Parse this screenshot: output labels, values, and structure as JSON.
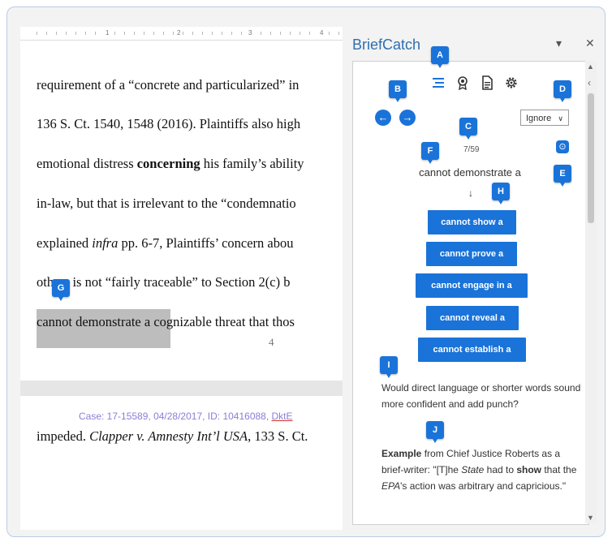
{
  "document": {
    "ruler_numbers": [
      "1",
      "2",
      "3",
      "4"
    ],
    "lines": [
      {
        "parts": [
          {
            "t": "requirement of a “concrete and particularized” in"
          }
        ]
      },
      {
        "parts": [
          {
            "t": "136 S. Ct. 1540, 1548 (2016).  Plaintiffs also high"
          }
        ]
      },
      {
        "parts": [
          {
            "t": "emotional distress "
          },
          {
            "t": "concerning",
            "b": true
          },
          {
            "t": " his family’s ability"
          }
        ]
      },
      {
        "parts": [
          {
            "t": "in-law, but that is irrelevant to the “condemnatio"
          }
        ]
      },
      {
        "parts": [
          {
            "t": "explained "
          },
          {
            "t": "infra",
            "i": true
          },
          {
            "t": " pp. 6-7, Plaintiffs’ concern abou"
          }
        ]
      },
      {
        "parts": [
          {
            "t": "others is not “fairly traceable” to Section 2(c) b"
          }
        ]
      },
      {
        "parts": [
          {
            "t": "cannot demonstrate a cognizable threat that thos"
          }
        ]
      }
    ],
    "page_number": "4",
    "case_line": "Case: 17-15589, 04/28/2017, ID: 10416088, ",
    "case_line_link": "DktE",
    "page2_line": [
      {
        "t": "impeded. "
      },
      {
        "t": "Clapper v. Amnesty Int’l USA",
        "i": true
      },
      {
        "t": ", 133 S. Ct."
      }
    ]
  },
  "pane": {
    "title": "BriefCatch",
    "dropdown_glyph": "▾",
    "close_glyph": "✕",
    "collapse_glyph": "‹",
    "toolbar_icons": [
      "list-icon",
      "ribbon-badge-icon",
      "document-icon",
      "gear-icon"
    ],
    "prev_glyph": "←",
    "next_glyph": "→",
    "ignore_label": "Ignore",
    "counter": "7/59",
    "phrase": "cannot demonstrate a",
    "arrow": "↓",
    "suggestions": [
      "cannot show a",
      "cannot prove a",
      "cannot engage in a",
      "cannot reveal a",
      "cannot establish a"
    ],
    "tip": "Would direct language or shorter words sound more confident and add punch?",
    "example_label": "Example",
    "example_text": [
      {
        "t": " from Chief Justice Roberts as a brief-writer: \"[T]he "
      },
      {
        "t": "State",
        "i": true
      },
      {
        "t": " had to "
      },
      {
        "t": "show",
        "b": true
      },
      {
        "t": " that the "
      },
      {
        "t": "EPA",
        "i": true
      },
      {
        "t": "'s action was arbitrary and capricious.\""
      }
    ]
  },
  "callouts": [
    "A",
    "B",
    "C",
    "D",
    "E",
    "F",
    "G",
    "H",
    "I",
    "J"
  ],
  "colors": {
    "accent": "#1a73d9",
    "title": "#2e6fb0",
    "highlight": "#bdbdbd",
    "case_line": "#8a7fd6"
  }
}
